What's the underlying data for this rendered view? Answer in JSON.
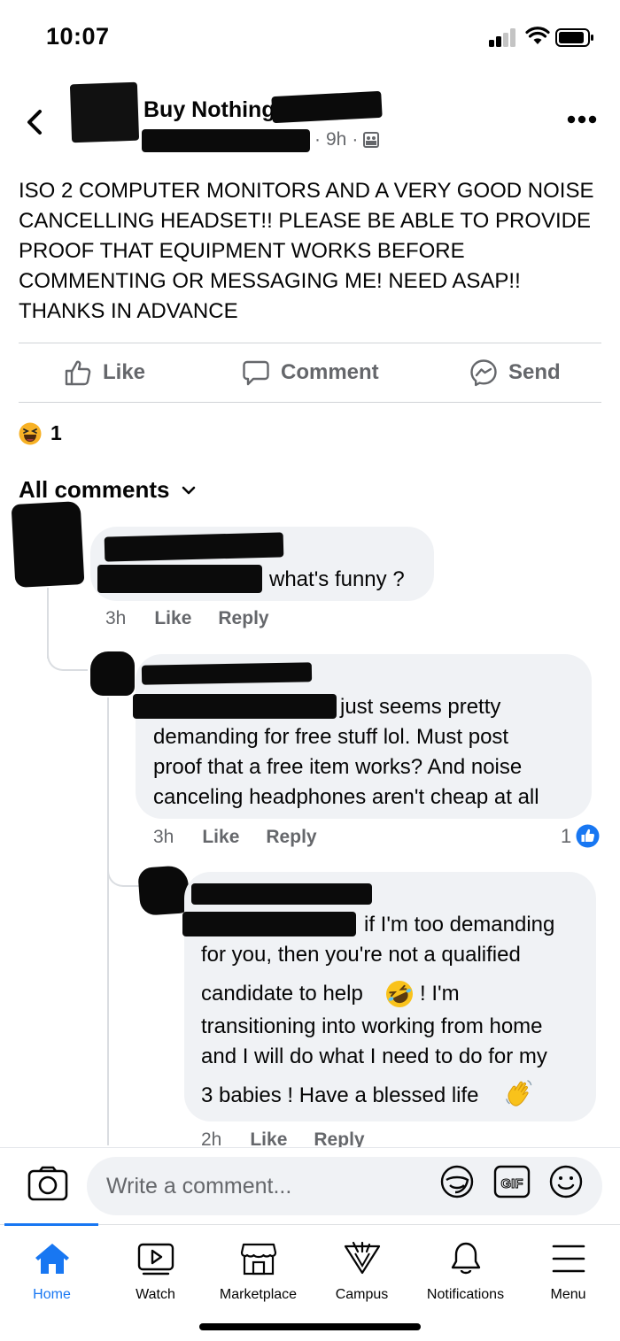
{
  "status_bar": {
    "time": "10:07"
  },
  "post": {
    "group_name": "Buy Nothing",
    "age": "9h",
    "text": "ISO 2 COMPUTER MONITORS AND A VERY GOOD NOISE CANCELLING HEADSET!! PLEASE BE ABLE TO PROVIDE PROOF THAT EQUIPMENT WORKS BEFORE COMMENTING OR MESSAGING ME! NEED ASAP!! THANKS IN ADVANCE",
    "actions": {
      "like": "Like",
      "comment": "Comment",
      "send": "Send"
    },
    "reaction_count": "1",
    "reaction_icon": "haha-emoji"
  },
  "comments_header": {
    "label": "All comments"
  },
  "comments": [
    {
      "text": "what's funny ?",
      "time": "3h",
      "like_label": "Like",
      "reply_label": "Reply"
    },
    {
      "text_line1": "just seems pretty",
      "text_rest": [
        "demanding for free stuff lol. Must post",
        "proof that a free item works? And noise",
        "canceling headphones aren't cheap at all"
      ],
      "time": "3h",
      "like_label": "Like",
      "reply_label": "Reply",
      "like_count": "1"
    },
    {
      "text_line1": "if I'm too demanding",
      "text_line2": "for you, then you're not a qualified",
      "text_line3a": "candidate to help",
      "text_line3b": "! I'm",
      "text_line4": "transitioning into working from home",
      "text_line5": "and I will do what I need to do for my",
      "text_line6": "3 babies ! Have a blessed life",
      "time": "2h",
      "like_label": "Like",
      "reply_label": "Reply"
    }
  ],
  "composer": {
    "placeholder": "Write a comment..."
  },
  "tabbar": {
    "tabs": [
      {
        "label": "Home",
        "icon": "home-icon"
      },
      {
        "label": "Watch",
        "icon": "watch-icon"
      },
      {
        "label": "Marketplace",
        "icon": "marketplace-icon"
      },
      {
        "label": "Campus",
        "icon": "campus-icon"
      },
      {
        "label": "Notifications",
        "icon": "bell-icon"
      },
      {
        "label": "Menu",
        "icon": "menu-icon"
      }
    ]
  },
  "colors": {
    "accent": "#1877f2",
    "secondary_text": "#65676b",
    "bubble": "#f0f2f5"
  }
}
